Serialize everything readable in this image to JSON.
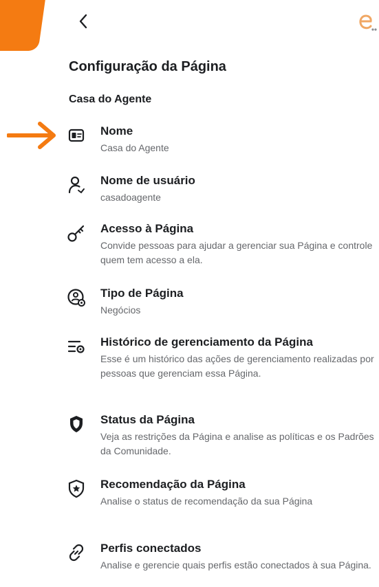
{
  "header": {
    "back_icon": "chevron-left-icon",
    "logo_icon": "e-logo-icon",
    "accent_color": "#f47b12"
  },
  "page_title": "Configuração da Página",
  "section_title": "Casa do Agente",
  "items": [
    {
      "icon": "id-card-icon",
      "label": "Nome",
      "desc": "Casa do Agente"
    },
    {
      "icon": "user-icon",
      "label": "Nome de usuário",
      "desc": "casadoagente"
    },
    {
      "icon": "key-icon",
      "label": "Acesso à Página",
      "desc": "Convide pessoas para ajudar a gerenciar sua Página e controle quem tem acesso a ela."
    },
    {
      "icon": "page-type-icon",
      "label": "Tipo de Página",
      "desc": "Negócios"
    },
    {
      "icon": "history-list-icon",
      "label": "Histórico de gerenciamento da Página",
      "desc": "Esse é um histórico das ações de gerenciamento realizadas por pessoas que gerenciam essa Página."
    },
    {
      "icon": "shield-icon",
      "label": "Status da Página",
      "desc": "Veja as restrições da Página e analise as políticas e os Padrões da Comunidade."
    },
    {
      "icon": "star-shield-icon",
      "label": "Recomendação da Página",
      "desc": "Analise o status de recomendação da sua Página"
    },
    {
      "icon": "link-icon",
      "label": "Perfis conectados",
      "desc": "Analise e gerencie quais perfis estão conectados à sua Página."
    }
  ]
}
